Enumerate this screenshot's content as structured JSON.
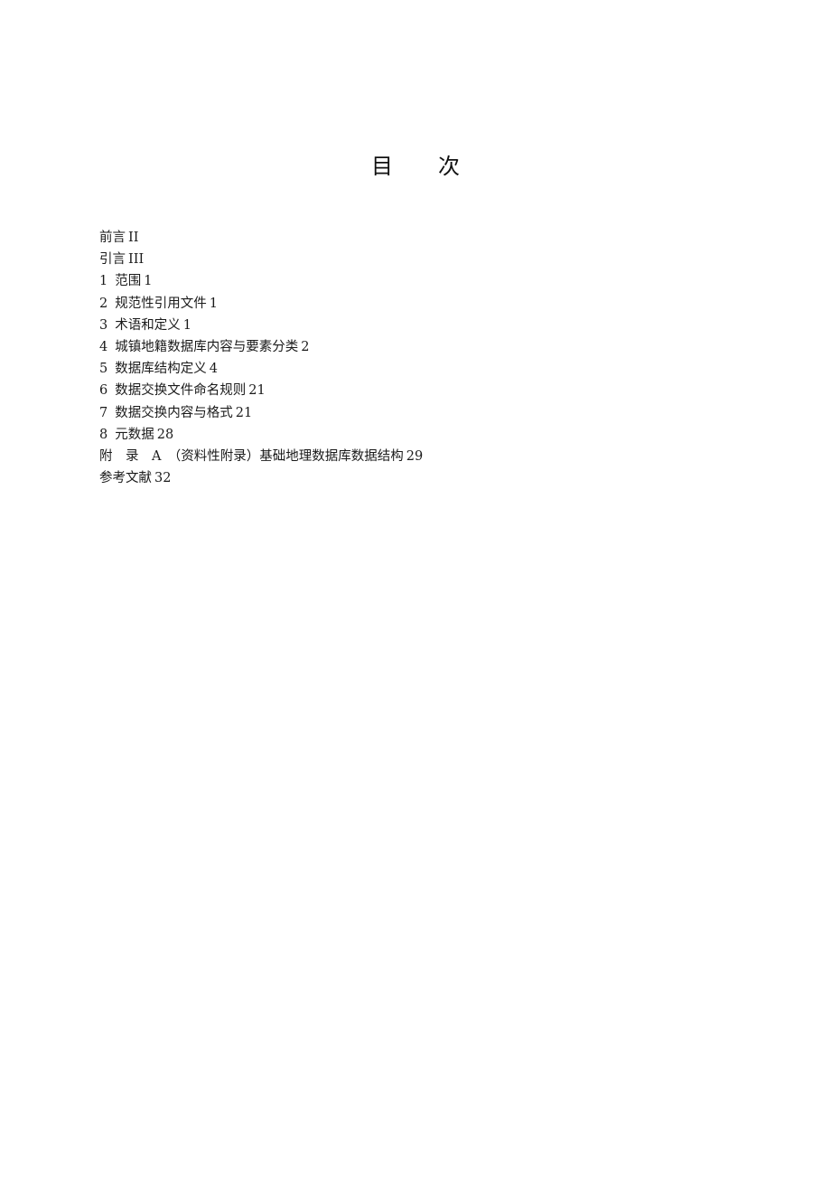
{
  "document": {
    "title_chars": [
      "目",
      "次"
    ],
    "toc": [
      {
        "number": "",
        "label": "前言",
        "page": "II"
      },
      {
        "number": "",
        "label": "引言",
        "page": "III"
      },
      {
        "number": "1",
        "label": "范围",
        "page": "1"
      },
      {
        "number": "2",
        "label": "规范性引用文件",
        "page": "1"
      },
      {
        "number": "3",
        "label": "术语和定义",
        "page": "1"
      },
      {
        "number": "4",
        "label": "城镇地籍数据库内容与要素分类",
        "page": "2"
      },
      {
        "number": "5",
        "label": "数据库结构定义",
        "page": "4"
      },
      {
        "number": "6",
        "label": "数据交换文件命名规则",
        "page": "21"
      },
      {
        "number": "7",
        "label": "数据交换内容与格式",
        "page": "21"
      },
      {
        "number": "8",
        "label": "元数据",
        "page": "28"
      },
      {
        "number": "",
        "label": "附　录　A　（资料性附录）基础地理数据库数据结构",
        "page": "29"
      },
      {
        "number": "",
        "label": "参考文献",
        "page": "32"
      }
    ]
  }
}
